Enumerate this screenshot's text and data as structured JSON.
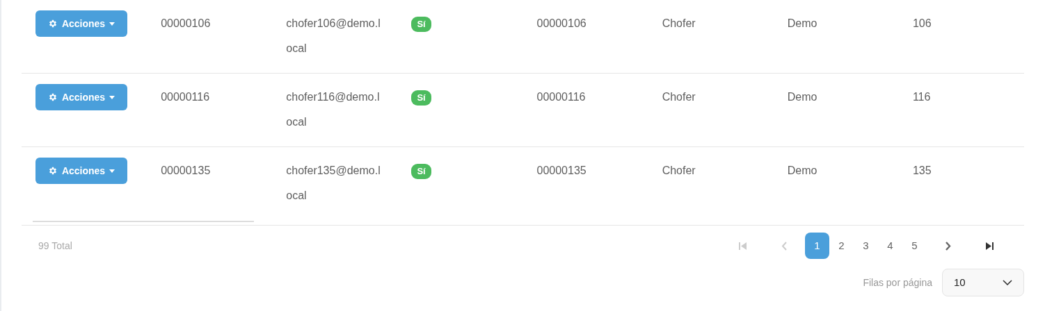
{
  "rows": [
    {
      "action": "Acciones",
      "code": "00000106",
      "email": "chofer106@demo.local",
      "active": "Sí",
      "id_number": "00000106",
      "role": "Chofer",
      "company": "Demo",
      "number": "106"
    },
    {
      "action": "Acciones",
      "code": "00000116",
      "email": "chofer116@demo.local",
      "active": "Sí",
      "id_number": "00000116",
      "role": "Chofer",
      "company": "Demo",
      "number": "116"
    },
    {
      "action": "Acciones",
      "code": "00000135",
      "email": "chofer135@demo.local",
      "active": "Sí",
      "id_number": "00000135",
      "role": "Chofer",
      "company": "Demo",
      "number": "135"
    }
  ],
  "total": "99 Total",
  "pagination": {
    "pages": [
      {
        "label": "1",
        "selected": true
      },
      {
        "label": "2",
        "selected": false
      },
      {
        "label": "3",
        "selected": false
      },
      {
        "label": "4",
        "selected": false
      },
      {
        "label": "5",
        "selected": false
      }
    ],
    "first_disabled": true,
    "prev_disabled": true
  },
  "rows_per_page": {
    "label": "Filas por página",
    "value": "10"
  }
}
